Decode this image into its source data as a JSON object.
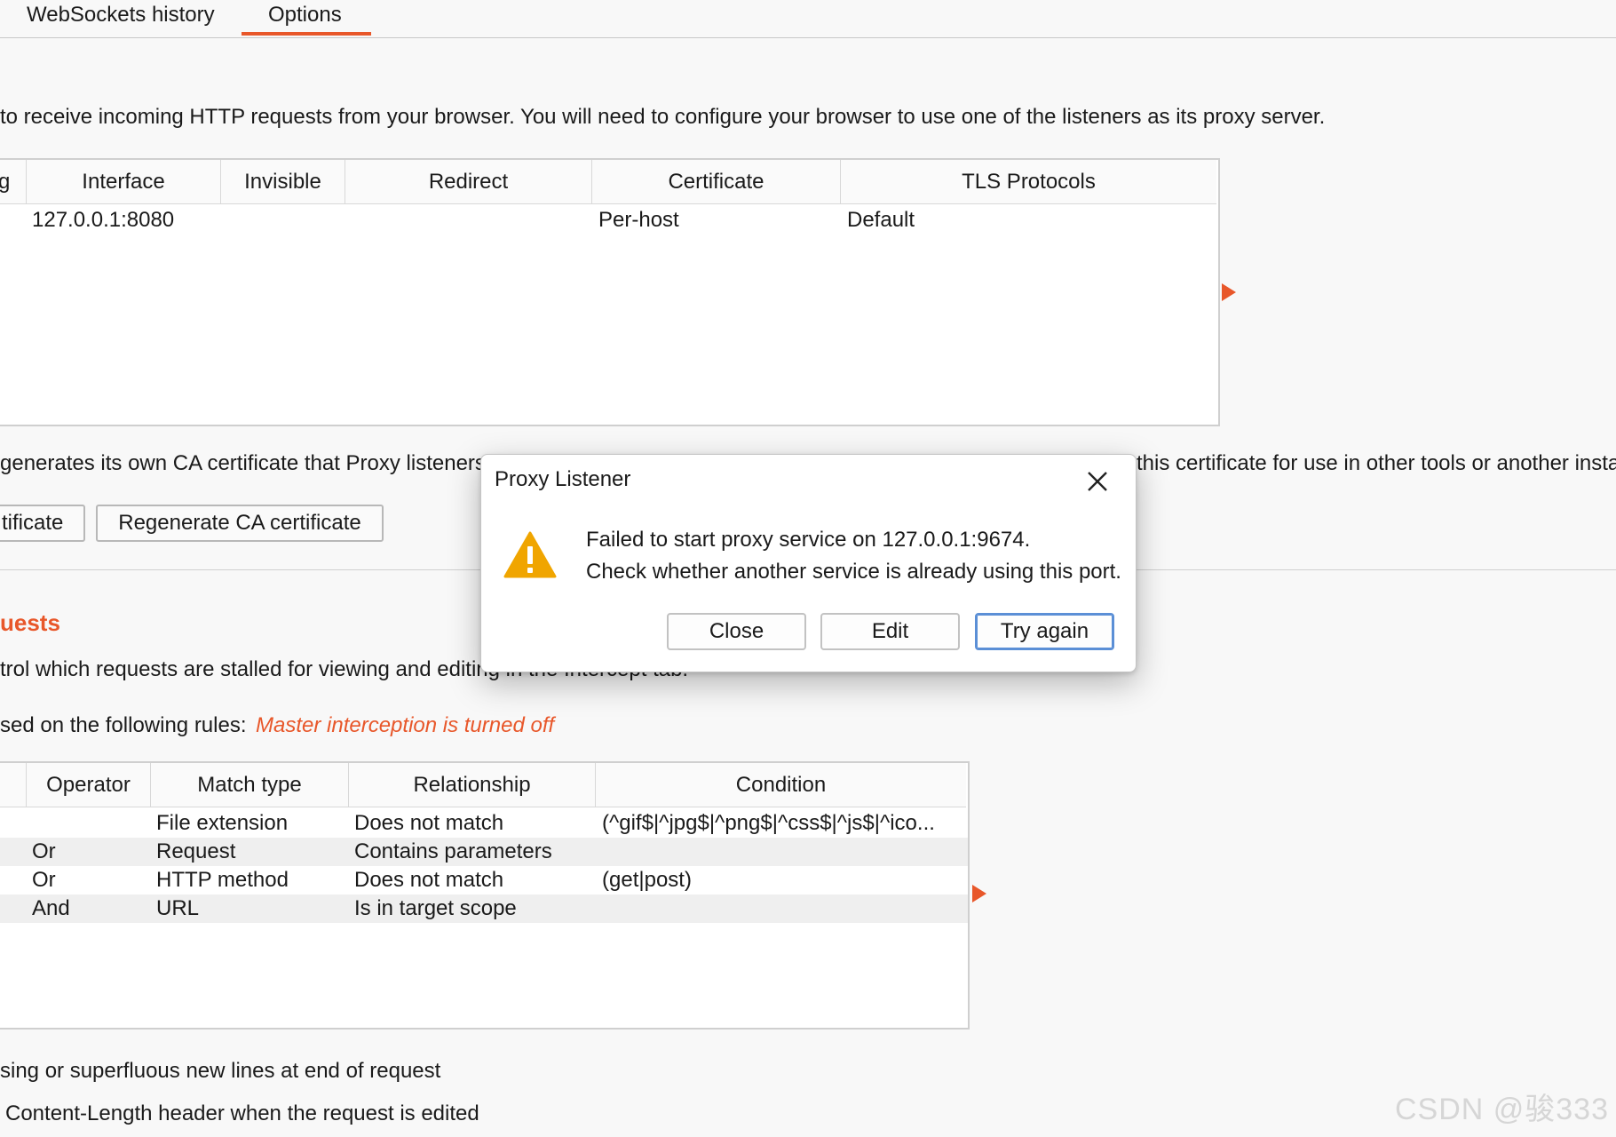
{
  "tabs": [
    {
      "label": "WebSockets history",
      "active": false
    },
    {
      "label": "Options",
      "active": true
    }
  ],
  "listeners": {
    "description": "to receive incoming HTTP requests from your browser. You will need to configure your browser to use one of the listeners as its proxy server.",
    "columns": [
      "g",
      "Interface",
      "Invisible",
      "Redirect",
      "Certificate",
      "TLS Protocols"
    ],
    "rows": [
      {
        "interface": "127.0.0.1:8080",
        "invisible": "",
        "redirect": "",
        "certificate": "Per-host",
        "tls": "Default"
      }
    ]
  },
  "ca": {
    "description_left": "generates its own CA certificate that Proxy listeners",
    "description_right": "this certificate for use in other tools or another insta",
    "import_button": "tificate",
    "regenerate_button": "Regenerate CA certificate"
  },
  "intercept": {
    "section_title": "uests",
    "description": "trol which requests are stalled for viewing and editing in the Intercept tab.",
    "rules_label": "sed on the following rules:",
    "master_status": "Master interception is turned off",
    "columns": [
      "",
      "Operator",
      "Match type",
      "Relationship",
      "Condition"
    ],
    "rows": [
      {
        "operator": "",
        "match_type": "File extension",
        "relationship": "Does not match",
        "condition": "(^gif$|^jpg$|^png$|^css$|^js$|^ico..."
      },
      {
        "operator": "Or",
        "match_type": "Request",
        "relationship": "Contains parameters",
        "condition": ""
      },
      {
        "operator": "Or",
        "match_type": "HTTP method",
        "relationship": "Does not match",
        "condition": "(get|post)"
      },
      {
        "operator": "And",
        "match_type": "URL",
        "relationship": "Is in target scope",
        "condition": ""
      }
    ]
  },
  "options": {
    "line1": "sing or superfluous new lines at end of request",
    "line2": "Content-Length header when the request is edited"
  },
  "dialog": {
    "title": "Proxy Listener",
    "message_line1": "Failed to start proxy service on 127.0.0.1:9674.",
    "message_line2": "Check whether another service is already using this port.",
    "buttons": {
      "close": "Close",
      "edit": "Edit",
      "try_again": "Try again"
    }
  },
  "watermark": "CSDN @骏333",
  "colors": {
    "accent": "#e8572a",
    "warning": "#f0a500",
    "focus": "#5b8fd6"
  }
}
